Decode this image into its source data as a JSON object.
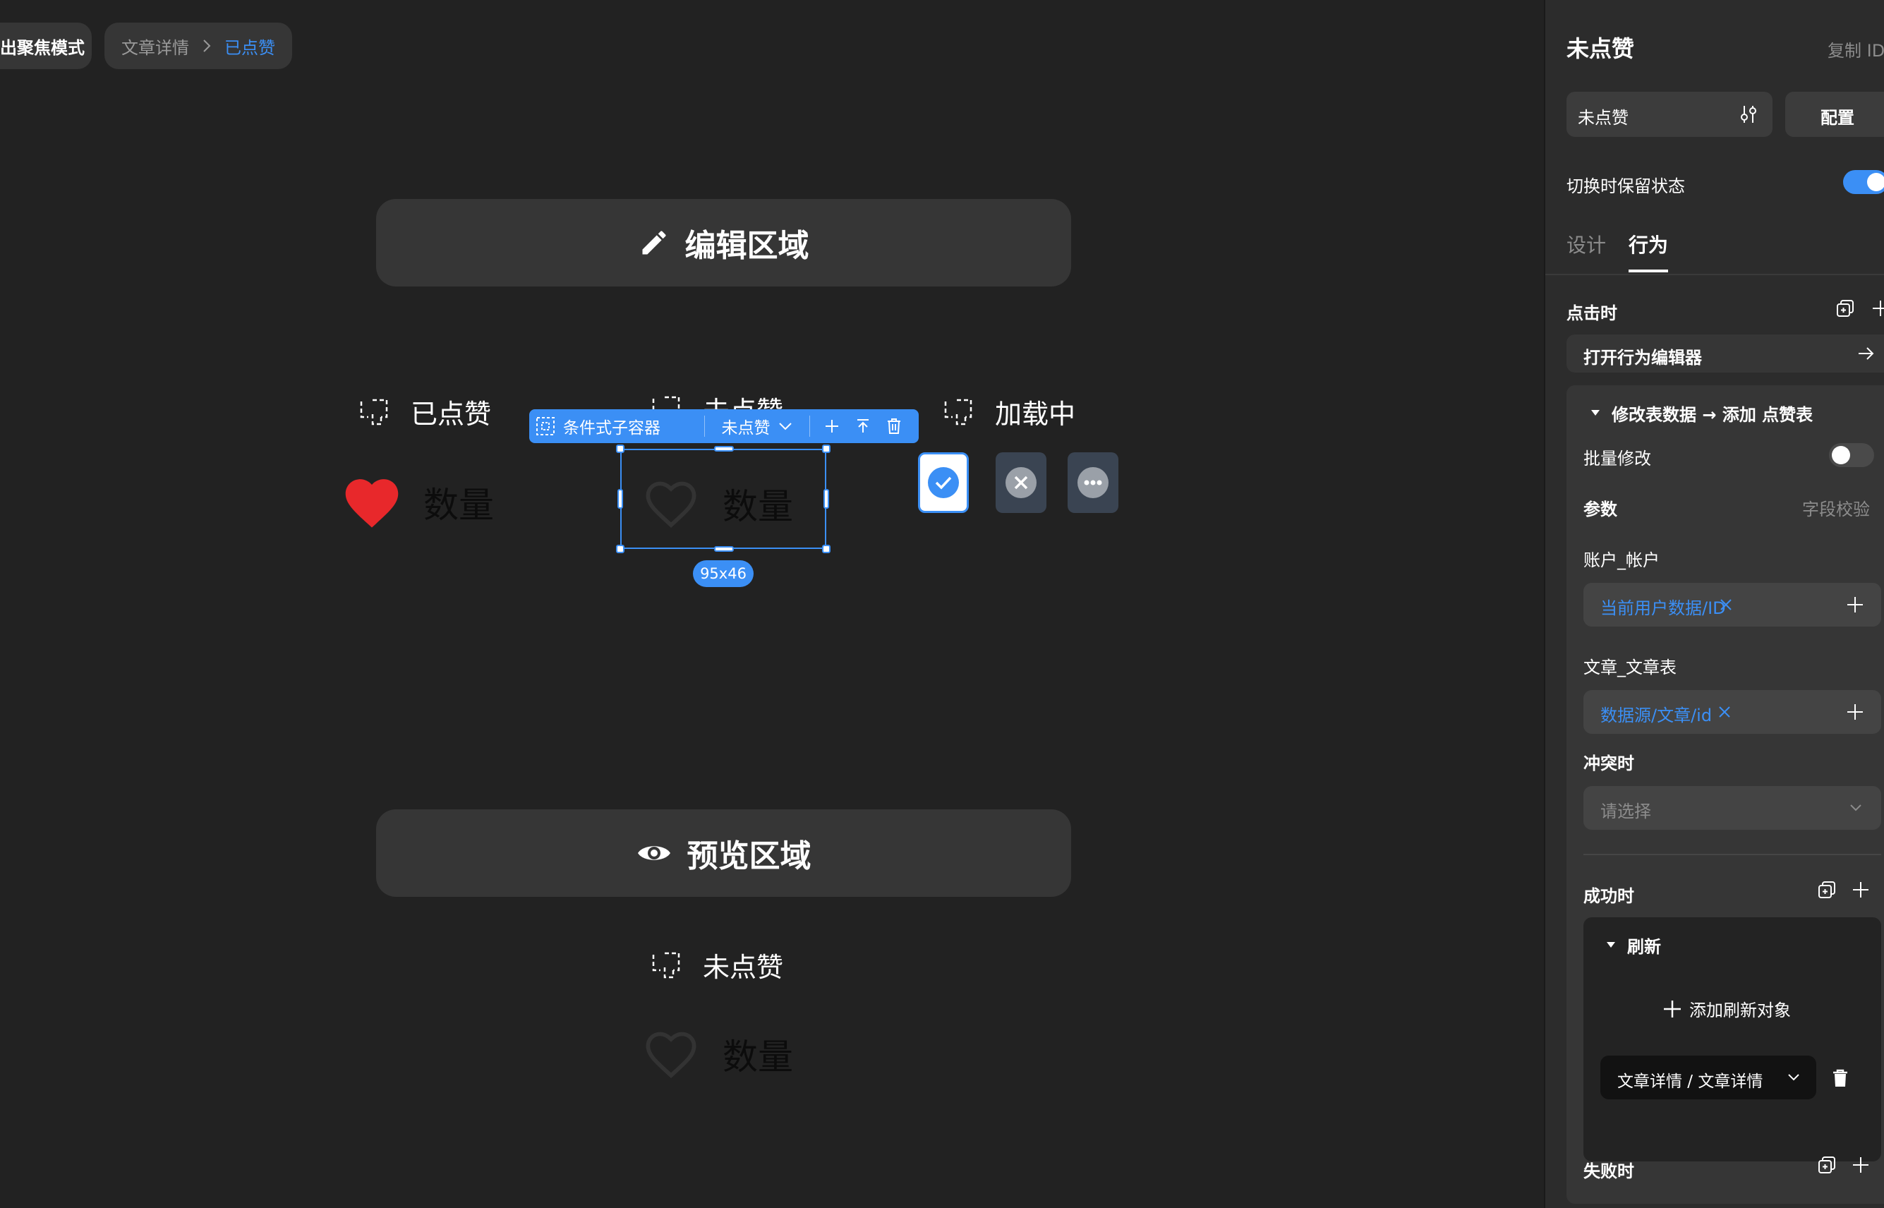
{
  "header": {
    "exit_focus": "出聚焦模式",
    "breadcrumb": {
      "parent": "文章详情",
      "current": "已点赞"
    }
  },
  "canvas": {
    "edit_zone": "编辑区域",
    "preview_zone": "预览区域",
    "state_liked": "已点赞",
    "state_unliked": "未点赞",
    "state_loading": "加载中",
    "count_label": "数量",
    "toolbar": {
      "container_label": "条件式子容器",
      "state_select": "未点赞"
    },
    "size_badge": "95x46",
    "preview_state_label": "未点赞",
    "colors": {
      "accent": "#3b8ff5",
      "heart_liked": "#e8282b"
    }
  },
  "panel": {
    "title": "未点赞",
    "copy_id": "复制 ID",
    "state_select": "未点赞",
    "config_button": "配置",
    "keep_state_label": "切换时保留状态",
    "keep_state_on": true,
    "tabs": [
      "设计",
      "行为"
    ],
    "active_tab": "行为",
    "on_click_label": "点击时",
    "open_editor_label": "打开行为编辑器",
    "action_title": "修改表数据 → 添加 点赞表",
    "batch_edit_label": "批量修改",
    "batch_edit_on": false,
    "params_label": "参数",
    "field_validation": "字段校验",
    "field1_label": "账户_帐户",
    "field1_value": "当前用户数据/ID",
    "field2_label": "文章_文章表",
    "field2_value": "数据源/文章/id",
    "conflict_label": "冲突时",
    "conflict_placeholder": "请选择",
    "success_label": "成功时",
    "refresh_label": "刷新",
    "add_refresh_label": "添加刷新对象",
    "refresh_target": "文章详情 / 文章详情",
    "fail_label": "失败时"
  }
}
